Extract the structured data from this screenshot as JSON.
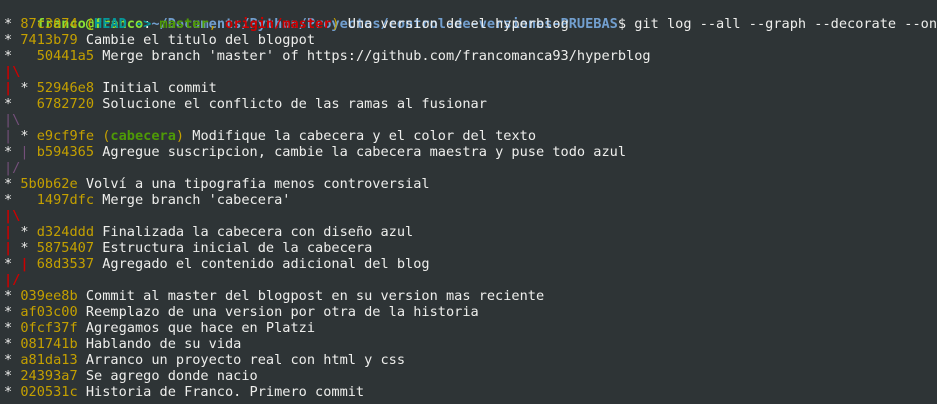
{
  "prompt": {
    "user_host": "franco@franco",
    "separator": ":",
    "path": "~/Documents/Python/Proyectos/control-de-versiones-PRUEBAS",
    "symbol": "$ ",
    "command": "git log --all --graph --decorate --oneline"
  },
  "colors": {
    "background": "#2e3436",
    "text": "#eeeeec",
    "hash": "#c4a000",
    "head": "#06989a",
    "branch_local": "#4e9a06",
    "branch_remote": "#cc0000",
    "graph_lane_2": "#cc0000",
    "graph_lane_3": "#75507b",
    "prompt_user": "#8ae234",
    "prompt_path": "#729fcf"
  },
  "lines": [
    [
      {
        "t": "* ",
        "c": "c-default"
      },
      {
        "t": "87c3074",
        "c": "c-yellow"
      },
      {
        "t": " (",
        "c": "c-yellow"
      },
      {
        "t": "HEAD -> ",
        "c": "c-cyan-b"
      },
      {
        "t": "master",
        "c": "c-green-b"
      },
      {
        "t": ", ",
        "c": "c-yellow"
      },
      {
        "t": "origin/master",
        "c": "c-red-b"
      },
      {
        "t": ")",
        "c": "c-yellow"
      },
      {
        "t": " Una version de el hyperblog",
        "c": "c-default"
      }
    ],
    [
      {
        "t": "* ",
        "c": "c-default"
      },
      {
        "t": "7413b79",
        "c": "c-yellow"
      },
      {
        "t": " Cambie el titulo del blogpot",
        "c": "c-default"
      }
    ],
    [
      {
        "t": "*   ",
        "c": "c-default"
      },
      {
        "t": "50441a5",
        "c": "c-yellow"
      },
      {
        "t": " Merge branch 'master' of https://github.com/francomanca93/hyperblog",
        "c": "c-default"
      }
    ],
    [
      {
        "t": "|\\",
        "c": "c-red-b"
      }
    ],
    [
      {
        "t": "| ",
        "c": "c-red-b"
      },
      {
        "t": "* ",
        "c": "c-default"
      },
      {
        "t": "52946e8",
        "c": "c-yellow"
      },
      {
        "t": " Initial commit",
        "c": "c-default"
      }
    ],
    [
      {
        "t": "*   ",
        "c": "c-default"
      },
      {
        "t": "6782720",
        "c": "c-yellow"
      },
      {
        "t": " Solucione el conflicto de las ramas al fusionar",
        "c": "c-default"
      }
    ],
    [
      {
        "t": "|\\",
        "c": "c-magenta"
      }
    ],
    [
      {
        "t": "| ",
        "c": "c-magenta"
      },
      {
        "t": "* ",
        "c": "c-default"
      },
      {
        "t": "e9cf9fe",
        "c": "c-yellow"
      },
      {
        "t": " (",
        "c": "c-yellow"
      },
      {
        "t": "cabecera",
        "c": "c-green-b"
      },
      {
        "t": ")",
        "c": "c-yellow"
      },
      {
        "t": " Modifique la cabecera y el color del texto",
        "c": "c-default"
      }
    ],
    [
      {
        "t": "* ",
        "c": "c-default"
      },
      {
        "t": "| ",
        "c": "c-magenta"
      },
      {
        "t": "b594365",
        "c": "c-yellow"
      },
      {
        "t": " Agregue suscripcion, cambie la cabecera maestra y puse todo azul",
        "c": "c-default"
      }
    ],
    [
      {
        "t": "|/",
        "c": "c-magenta"
      }
    ],
    [
      {
        "t": "* ",
        "c": "c-default"
      },
      {
        "t": "5b0b62e",
        "c": "c-yellow"
      },
      {
        "t": " Volví a una tipografia menos controversial",
        "c": "c-default"
      }
    ],
    [
      {
        "t": "*   ",
        "c": "c-default"
      },
      {
        "t": "1497dfc",
        "c": "c-yellow"
      },
      {
        "t": " Merge branch 'cabecera'",
        "c": "c-default"
      }
    ],
    [
      {
        "t": "|\\",
        "c": "c-red-b"
      }
    ],
    [
      {
        "t": "| ",
        "c": "c-red-b"
      },
      {
        "t": "* ",
        "c": "c-default"
      },
      {
        "t": "d324ddd",
        "c": "c-yellow"
      },
      {
        "t": " Finalizada la cabecera con diseño azul",
        "c": "c-default"
      }
    ],
    [
      {
        "t": "| ",
        "c": "c-red-b"
      },
      {
        "t": "* ",
        "c": "c-default"
      },
      {
        "t": "5875407",
        "c": "c-yellow"
      },
      {
        "t": " Estructura inicial de la cabecera",
        "c": "c-default"
      }
    ],
    [
      {
        "t": "* ",
        "c": "c-default"
      },
      {
        "t": "| ",
        "c": "c-red-b"
      },
      {
        "t": "68d3537",
        "c": "c-yellow"
      },
      {
        "t": " Agregado el contenido adicional del blog",
        "c": "c-default"
      }
    ],
    [
      {
        "t": "|/",
        "c": "c-red-b"
      }
    ],
    [
      {
        "t": "* ",
        "c": "c-default"
      },
      {
        "t": "039ee8b",
        "c": "c-yellow"
      },
      {
        "t": " Commit al master del blogpost en su version mas reciente",
        "c": "c-default"
      }
    ],
    [
      {
        "t": "* ",
        "c": "c-default"
      },
      {
        "t": "af03c00",
        "c": "c-yellow"
      },
      {
        "t": " Reemplazo de una version por otra de la historia",
        "c": "c-default"
      }
    ],
    [
      {
        "t": "* ",
        "c": "c-default"
      },
      {
        "t": "0fcf37f",
        "c": "c-yellow"
      },
      {
        "t": " Agregamos que hace en Platzi",
        "c": "c-default"
      }
    ],
    [
      {
        "t": "* ",
        "c": "c-default"
      },
      {
        "t": "081741b",
        "c": "c-yellow"
      },
      {
        "t": " Hablando de su vida",
        "c": "c-default"
      }
    ],
    [
      {
        "t": "* ",
        "c": "c-default"
      },
      {
        "t": "a81da13",
        "c": "c-yellow"
      },
      {
        "t": " Arranco un proyecto real con html y css",
        "c": "c-default"
      }
    ],
    [
      {
        "t": "* ",
        "c": "c-default"
      },
      {
        "t": "24393a7",
        "c": "c-yellow"
      },
      {
        "t": " Se agrego donde nacio",
        "c": "c-default"
      }
    ],
    [
      {
        "t": "* ",
        "c": "c-default"
      },
      {
        "t": "020531c",
        "c": "c-yellow"
      },
      {
        "t": " Historia de Franco. Primero commit",
        "c": "c-default"
      }
    ]
  ]
}
